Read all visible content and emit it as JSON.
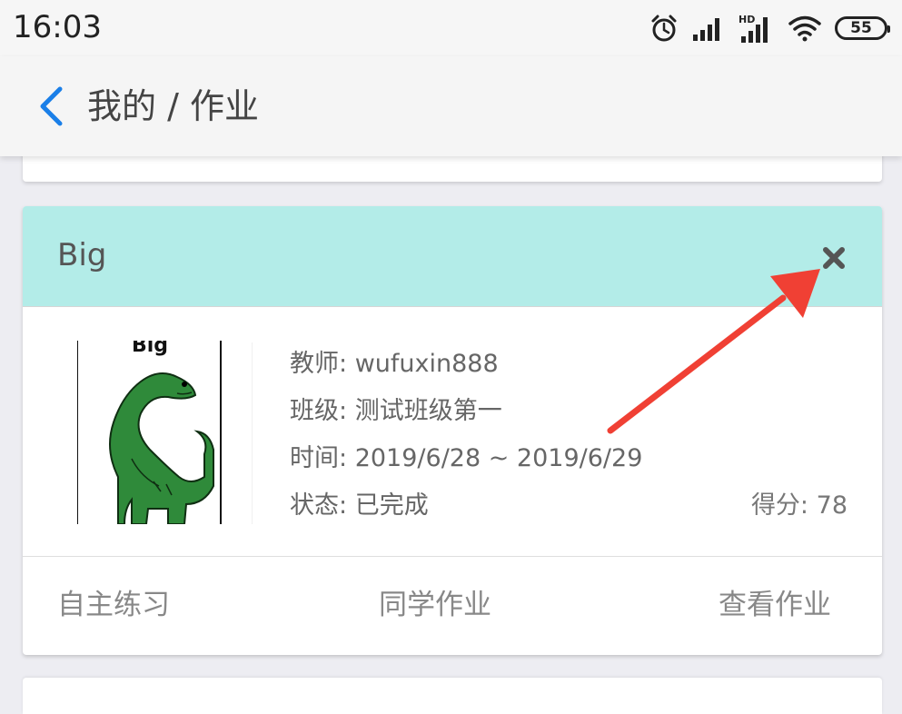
{
  "status_bar": {
    "time": "16:03",
    "battery": "55",
    "icons": [
      "alarm-icon",
      "signal-icon",
      "hd-signal-icon",
      "wifi-icon",
      "battery-icon"
    ]
  },
  "nav": {
    "back_icon": "chevron-left-icon",
    "title": "我的 / 作业"
  },
  "homework_card": {
    "title": "Big",
    "close_icon": "close-icon",
    "thumbnail": {
      "caption": "Big",
      "subject": "dinosaur-illustration"
    },
    "teacher_label": "教师:",
    "teacher": "wufuxin888",
    "class_label": "班级:",
    "class": "测试班级第一",
    "time_label": "时间:",
    "time": "2019/6/28 ~ 2019/6/29",
    "status_label": "状态:",
    "status": "已完成",
    "score_label": "得分:",
    "score": "78",
    "actions": {
      "self_practice": "自主练习",
      "classmates_homework": "同学作业",
      "view_homework": "查看作业"
    }
  },
  "colors": {
    "header_bg": "#b3ece8",
    "accent_blue": "#1a7fe8",
    "arrow_red": "#f04034",
    "background": "#ededf2"
  }
}
